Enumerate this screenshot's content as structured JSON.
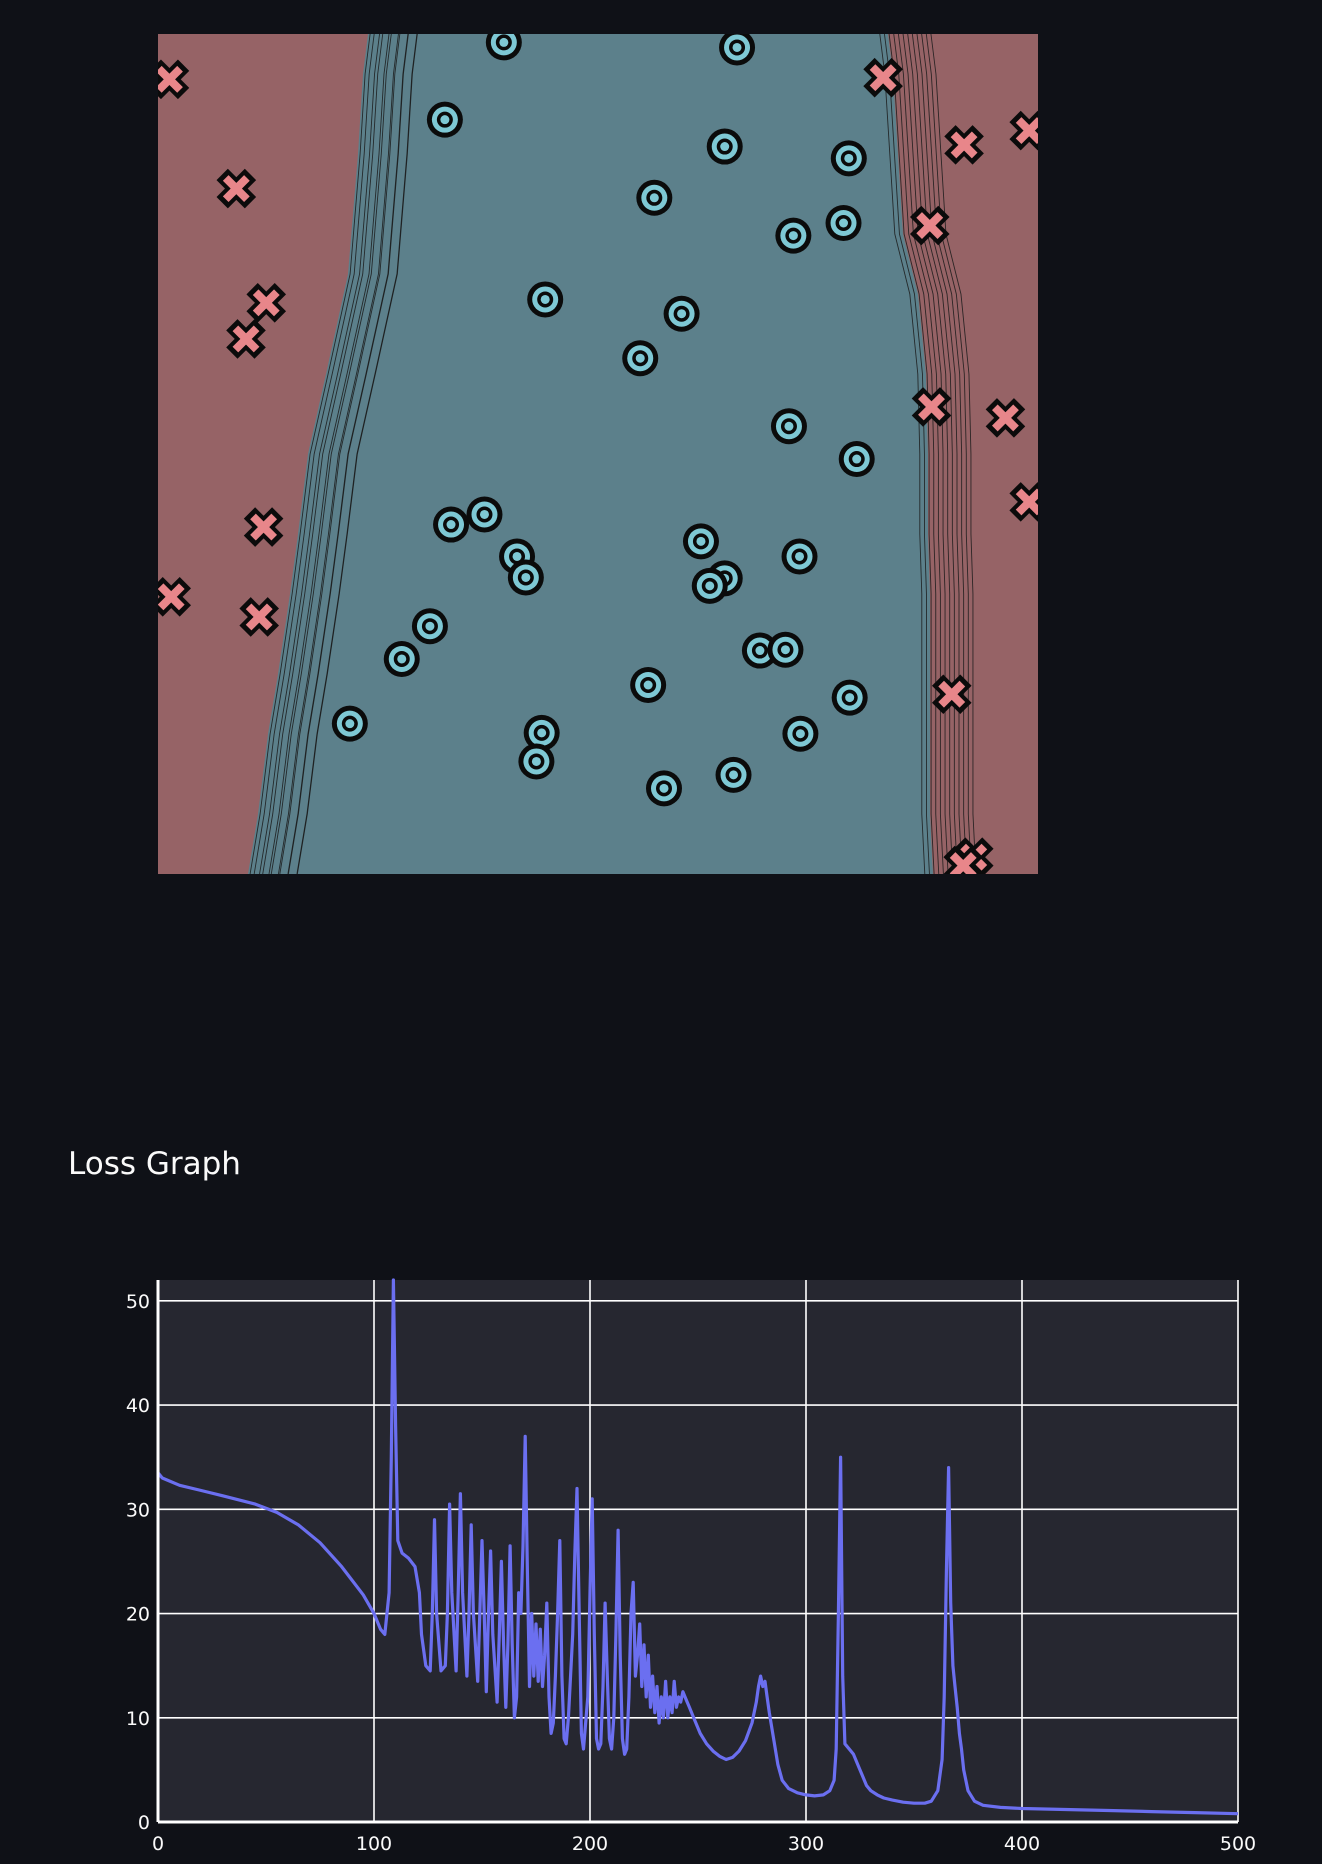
{
  "page": {
    "section_title": "Loss Graph"
  },
  "colors": {
    "background": "#0f1117",
    "class_a_region": "#966366",
    "class_b_region": "#5c808b",
    "class_a_marker": "#e8868a",
    "class_b_marker": "#7ec8d4",
    "loss_line": "#6b6ff0",
    "chart_bg": "#262730",
    "grid": "#ffffff"
  },
  "chart_data": [
    {
      "type": "scatter",
      "title": "",
      "xlabel": "",
      "ylabel": "",
      "xlim": [
        0,
        1
      ],
      "ylim": [
        0,
        1
      ],
      "grid": false,
      "legend": "none",
      "regions": [
        "class_a",
        "class_b",
        "class_a"
      ],
      "series": [
        {
          "marker": "x",
          "x": [
            0.013,
            0.089,
            0.123,
            0.1,
            0.12,
            0.015,
            0.115,
            0.824,
            0.916,
            0.99,
            0.877,
            0.879,
            0.963,
            0.99,
            0.902,
            0.927,
            0.915
          ],
          "y": [
            0.946,
            0.816,
            0.68,
            0.637,
            0.413,
            0.33,
            0.306,
            0.948,
            0.868,
            0.885,
            0.772,
            0.556,
            0.543,
            0.443,
            0.214,
            0.02,
            0.01
          ]
        },
        {
          "marker": "o",
          "x": [
            0.393,
            0.658,
            0.326,
            0.644,
            0.785,
            0.564,
            0.722,
            0.779,
            0.44,
            0.595,
            0.548,
            0.717,
            0.794,
            0.333,
            0.371,
            0.408,
            0.418,
            0.617,
            0.644,
            0.627,
            0.729,
            0.309,
            0.277,
            0.218,
            0.684,
            0.713,
            0.557,
            0.786,
            0.436,
            0.43,
            0.73,
            0.654,
            0.575
          ],
          "y": [
            0.99,
            0.984,
            0.898,
            0.866,
            0.852,
            0.805,
            0.76,
            0.775,
            0.684,
            0.667,
            0.614,
            0.533,
            0.494,
            0.416,
            0.428,
            0.378,
            0.353,
            0.396,
            0.352,
            0.343,
            0.378,
            0.295,
            0.256,
            0.179,
            0.266,
            0.267,
            0.225,
            0.21,
            0.168,
            0.134,
            0.167,
            0.118,
            0.102
          ]
        }
      ]
    },
    {
      "type": "line",
      "title": "Loss Graph",
      "xlabel": "",
      "ylabel": "",
      "xlim": [
        0,
        500
      ],
      "ylim": [
        0,
        52
      ],
      "grid": true,
      "legend": "none",
      "x_ticks": [
        "0",
        "100",
        "200",
        "300",
        "400",
        "500"
      ],
      "y_ticks": [
        "0",
        "10",
        "20",
        "30",
        "40",
        "50"
      ],
      "series": [
        {
          "points": [
            [
              0,
              33.5
            ],
            [
              2,
              33.0
            ],
            [
              10,
              32.3
            ],
            [
              20,
              31.8
            ],
            [
              30,
              31.3
            ],
            [
              45,
              30.5
            ],
            [
              55,
              29.7
            ],
            [
              65,
              28.5
            ],
            [
              75,
              26.8
            ],
            [
              85,
              24.5
            ],
            [
              95,
              21.8
            ],
            [
              100,
              20.0
            ],
            [
              103,
              18.5
            ],
            [
              105,
              18.0
            ],
            [
              107,
              22.0
            ],
            [
              108,
              35.0
            ],
            [
              109,
              52.0
            ],
            [
              110,
              38.0
            ],
            [
              111,
              27.0
            ],
            [
              113,
              25.8
            ],
            [
              116,
              25.3
            ],
            [
              119,
              24.5
            ],
            [
              121,
              22.0
            ],
            [
              122,
              18.0
            ],
            [
              124,
              15.0
            ],
            [
              126,
              14.5
            ],
            [
              127,
              20.0
            ],
            [
              128,
              29.0
            ],
            [
              129,
              20.0
            ],
            [
              131,
              14.5
            ],
            [
              133,
              15.0
            ],
            [
              134,
              20.0
            ],
            [
              135,
              30.5
            ],
            [
              136,
              22.0
            ],
            [
              138,
              14.5
            ],
            [
              139,
              22.0
            ],
            [
              140,
              31.5
            ],
            [
              141,
              22.0
            ],
            [
              143,
              14.0
            ],
            [
              144,
              20.0
            ],
            [
              145,
              28.5
            ],
            [
              146,
              20.0
            ],
            [
              148,
              13.5
            ],
            [
              149,
              20.0
            ],
            [
              150,
              27.0
            ],
            [
              151,
              20.0
            ],
            [
              152,
              12.5
            ],
            [
              153,
              20.0
            ],
            [
              154,
              26.0
            ],
            [
              155,
              18.0
            ],
            [
              157,
              11.5
            ],
            [
              158,
              18.0
            ],
            [
              159,
              25.0
            ],
            [
              160,
              17.0
            ],
            [
              161,
              11.0
            ],
            [
              162,
              17.0
            ],
            [
              163,
              26.5
            ],
            [
              164,
              17.0
            ],
            [
              165,
              10.0
            ],
            [
              166,
              12.0
            ],
            [
              167,
              22.0
            ],
            [
              168,
              20.0
            ],
            [
              169,
              26.5
            ],
            [
              170,
              37.0
            ],
            [
              171,
              24.0
            ],
            [
              172,
              13.0
            ],
            [
              173,
              20.0
            ],
            [
              174,
              14.0
            ],
            [
              175,
              19.0
            ],
            [
              176,
              13.5
            ],
            [
              177,
              18.5
            ],
            [
              178,
              13.0
            ],
            [
              179,
              16.0
            ],
            [
              180,
              21.0
            ],
            [
              181,
              12.0
            ],
            [
              182,
              8.5
            ],
            [
              183,
              9.5
            ],
            [
              184,
              14.0
            ],
            [
              185,
              20.0
            ],
            [
              186,
              27.0
            ],
            [
              187,
              14.0
            ],
            [
              188,
              8.0
            ],
            [
              189,
              7.5
            ],
            [
              190,
              10.0
            ],
            [
              192,
              18.0
            ],
            [
              193,
              26.0
            ],
            [
              194,
              32.0
            ],
            [
              195,
              20.0
            ],
            [
              196,
              8.5
            ],
            [
              197,
              7.0
            ],
            [
              199,
              12.0
            ],
            [
              200,
              22.0
            ],
            [
              201,
              31.0
            ],
            [
              202,
              18.0
            ],
            [
              203,
              8.0
            ],
            [
              204,
              7.0
            ],
            [
              205,
              7.5
            ],
            [
              206,
              13.0
            ],
            [
              207,
              21.0
            ],
            [
              208,
              14.0
            ],
            [
              209,
              8.0
            ],
            [
              210,
              7.0
            ],
            [
              211,
              10.0
            ],
            [
              212,
              18.0
            ],
            [
              213,
              28.0
            ],
            [
              214,
              16.0
            ],
            [
              215,
              8.0
            ],
            [
              216,
              6.5
            ],
            [
              217,
              7.0
            ],
            [
              218,
              12.0
            ],
            [
              219,
              20.0
            ],
            [
              220,
              23.0
            ],
            [
              221,
              14.0
            ],
            [
              222,
              16.0
            ],
            [
              223,
              19.0
            ],
            [
              224,
              13.0
            ],
            [
              225,
              17.0
            ],
            [
              226,
              12.0
            ],
            [
              227,
              16.0
            ],
            [
              228,
              11.0
            ],
            [
              229,
              14.0
            ],
            [
              230,
              10.5
            ],
            [
              231,
              13.0
            ],
            [
              232,
              9.5
            ],
            [
              233,
              12.0
            ],
            [
              234,
              10.0
            ],
            [
              235,
              13.5
            ],
            [
              236,
              10.0
            ],
            [
              237,
              12.0
            ],
            [
              238,
              10.5
            ],
            [
              239,
              13.5
            ],
            [
              240,
              11.0
            ],
            [
              241,
              12.0
            ],
            [
              242,
              11.5
            ],
            [
              243,
              12.5
            ],
            [
              244,
              12.0
            ],
            [
              245,
              11.5
            ],
            [
              246,
              11.0
            ],
            [
              248,
              10.0
            ],
            [
              251,
              8.5
            ],
            [
              254,
              7.5
            ],
            [
              257,
              6.8
            ],
            [
              260,
              6.3
            ],
            [
              263,
              6.0
            ],
            [
              266,
              6.2
            ],
            [
              269,
              6.8
            ],
            [
              272,
              7.8
            ],
            [
              275,
              9.5
            ],
            [
              277,
              11.5
            ],
            [
              278,
              13.0
            ],
            [
              279,
              14.0
            ],
            [
              280,
              13.0
            ],
            [
              281,
              13.5
            ],
            [
              282,
              12.0
            ],
            [
              283,
              10.5
            ],
            [
              285,
              8.0
            ],
            [
              287,
              5.5
            ],
            [
              289,
              4.0
            ],
            [
              292,
              3.2
            ],
            [
              296,
              2.8
            ],
            [
              300,
              2.6
            ],
            [
              304,
              2.5
            ],
            [
              308,
              2.6
            ],
            [
              311,
              3.0
            ],
            [
              313,
              4.0
            ],
            [
              314,
              7.0
            ],
            [
              315,
              20.0
            ],
            [
              316,
              35.0
            ],
            [
              317,
              14.0
            ],
            [
              318,
              7.5
            ],
            [
              320,
              7.0
            ],
            [
              322,
              6.5
            ],
            [
              324,
              5.5
            ],
            [
              326,
              4.5
            ],
            [
              328,
              3.5
            ],
            [
              330,
              3.0
            ],
            [
              333,
              2.6
            ],
            [
              336,
              2.3
            ],
            [
              340,
              2.1
            ],
            [
              345,
              1.9
            ],
            [
              350,
              1.8
            ],
            [
              355,
              1.8
            ],
            [
              358,
              2.0
            ],
            [
              361,
              3.0
            ],
            [
              363,
              6.0
            ],
            [
              364,
              12.0
            ],
            [
              365,
              24.0
            ],
            [
              366,
              34.0
            ],
            [
              367,
              21.0
            ],
            [
              368,
              15.0
            ],
            [
              369,
              13.0
            ],
            [
              370,
              11.0
            ],
            [
              371,
              8.5
            ],
            [
              372,
              7.0
            ],
            [
              373,
              5.0
            ],
            [
              375,
              3.0
            ],
            [
              378,
              2.0
            ],
            [
              382,
              1.6
            ],
            [
              390,
              1.4
            ],
            [
              400,
              1.3
            ],
            [
              420,
              1.2
            ],
            [
              440,
              1.1
            ],
            [
              460,
              1.0
            ],
            [
              480,
              0.9
            ],
            [
              500,
              0.8
            ]
          ]
        }
      ]
    }
  ]
}
